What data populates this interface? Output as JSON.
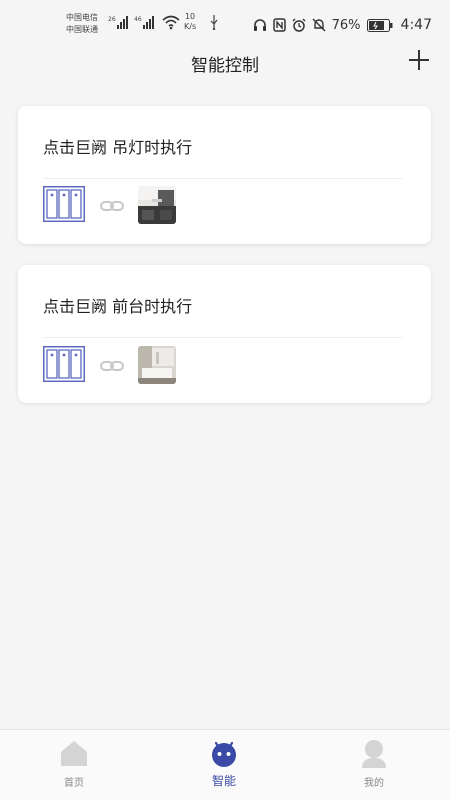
{
  "status_bar": {
    "carrier1": "中国电信",
    "carrier2": "中国联通",
    "speed_value": "10",
    "speed_unit": "K/s",
    "battery": "76%",
    "time": "4:47"
  },
  "header": {
    "title": "智能控制"
  },
  "scenes": [
    {
      "title": "点击巨阙 吊灯时执行"
    },
    {
      "title": "点击巨阙 前台时执行"
    }
  ],
  "tabs": [
    {
      "label": "首页"
    },
    {
      "label": "智能"
    },
    {
      "label": "我的"
    }
  ],
  "colors": {
    "accent": "#3b4aa6",
    "switch_outline": "#5b6bc0",
    "background": "#f5f5f5"
  }
}
